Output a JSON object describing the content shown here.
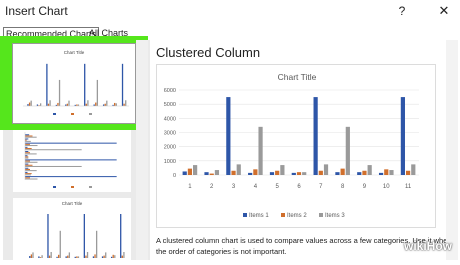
{
  "dialog": {
    "title": "Insert Chart",
    "help_label": "?",
    "close_label": "✕"
  },
  "tabs": [
    {
      "label": "Recommended Charts",
      "selected": true
    },
    {
      "label": "All Charts",
      "selected": false
    }
  ],
  "thumbnails": {
    "items": [
      {
        "name": "clustered-column",
        "title": "Chart Title",
        "selected": true
      },
      {
        "name": "clustered-bar",
        "title": "",
        "selected": false
      },
      {
        "name": "combo",
        "title": "Chart Title",
        "selected": false
      }
    ]
  },
  "preview": {
    "heading": "Clustered Column",
    "description": "A clustered column chart is used to compare values across a few categories. Use it when the order of categories is not important."
  },
  "chart_data": {
    "type": "bar",
    "title": "Chart Title",
    "xlabel": "",
    "ylabel": "",
    "categories": [
      "1",
      "2",
      "3",
      "4",
      "5",
      "6",
      "7",
      "8",
      "9",
      "10",
      "11"
    ],
    "ylim": [
      0,
      6000
    ],
    "yticks": [
      0,
      1000,
      2000,
      3000,
      4000,
      5000,
      6000
    ],
    "grid": true,
    "legend_position": "bottom",
    "series": [
      {
        "name": "Items 1",
        "color": "#2e56a8",
        "values": [
          250,
          200,
          5500,
          150,
          200,
          150,
          5500,
          200,
          200,
          150,
          5500
        ]
      },
      {
        "name": "Items 2",
        "color": "#d06f2c",
        "values": [
          450,
          100,
          300,
          400,
          300,
          200,
          300,
          450,
          300,
          400,
          300
        ]
      },
      {
        "name": "Items 3",
        "color": "#9a9a9a",
        "values": [
          700,
          350,
          750,
          3400,
          700,
          200,
          750,
          3400,
          700,
          350,
          750
        ]
      }
    ]
  },
  "watermark": "wikiHow"
}
